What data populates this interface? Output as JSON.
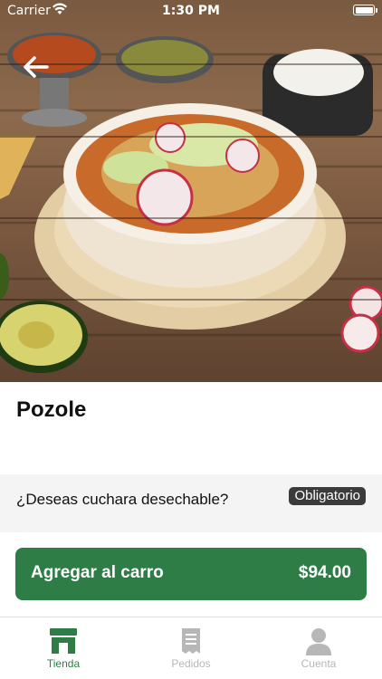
{
  "status_bar": {
    "carrier": "Carrier",
    "time": "1:30 PM"
  },
  "product": {
    "name": "Pozole",
    "image_icon": "pozole-bowl-photo"
  },
  "option": {
    "question": "¿Deseas cuchara desechable?",
    "badge": "Obligatorio"
  },
  "cart_button": {
    "label": "Agregar al carro",
    "price": "$94.00"
  },
  "tabs": [
    {
      "label": "Tienda",
      "icon": "store-icon",
      "active": true
    },
    {
      "label": "Pedidos",
      "icon": "receipt-icon",
      "active": false
    },
    {
      "label": "Cuenta",
      "icon": "user-icon",
      "active": false
    }
  ],
  "colors": {
    "accent": "#2e7d46",
    "badge_bg": "#3b3b3b",
    "inactive": "#b7b7b7"
  }
}
